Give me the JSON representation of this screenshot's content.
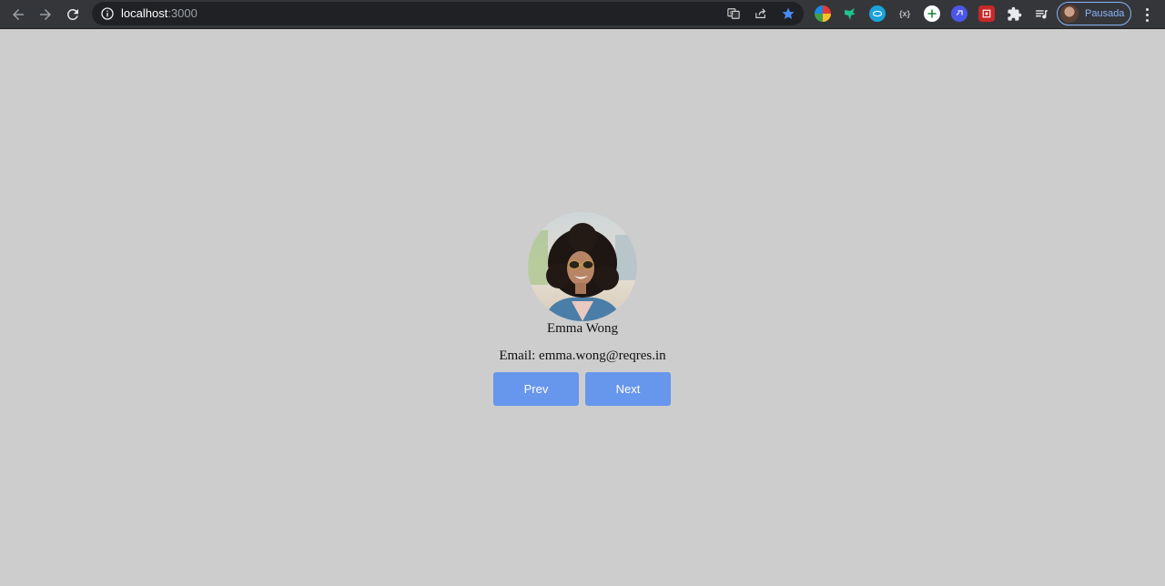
{
  "browser": {
    "url_host": "localhost",
    "url_port": ":3000",
    "profile_name": "Pausada",
    "icons": {
      "back": "back-arrow-icon",
      "forward": "forward-arrow-icon",
      "reload": "reload-icon",
      "site_info": "info-icon",
      "translate": "translate-icon",
      "share": "share-icon",
      "bookmark": "star-icon",
      "extensions": "puzzle-icon",
      "reading_list": "reading-list-icon",
      "menu": "kebab-menu-icon"
    },
    "colors": {
      "bookmark_star": "#4a8af4",
      "profile_border": "#8ab4f8"
    }
  },
  "user": {
    "name": "Emma Wong",
    "email_line": "Email: emma.wong@reqres.in"
  },
  "buttons": {
    "prev_label": "Prev",
    "next_label": "Next"
  },
  "theme": {
    "page_bg": "#cdcdcd",
    "button_bg": "#6796ed",
    "button_text": "#ffffff"
  }
}
